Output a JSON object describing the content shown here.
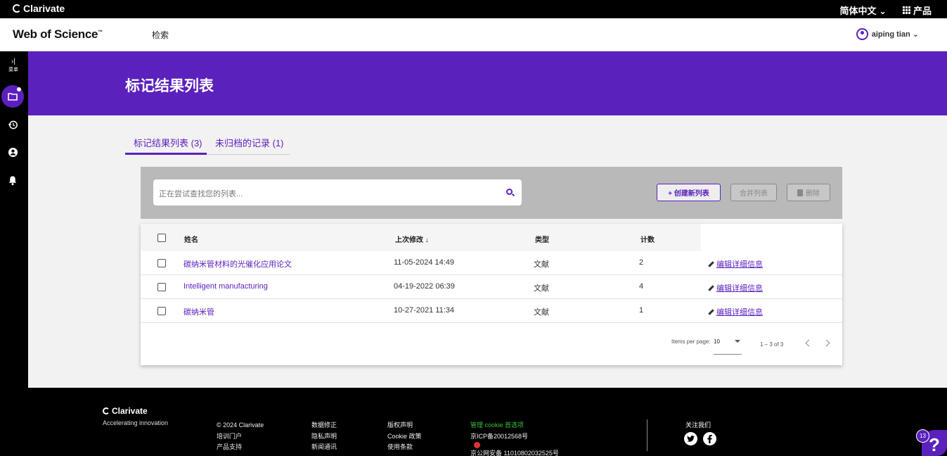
{
  "brand_bar": {
    "logo_text": "Clarivate",
    "language": "简体中文 ⌄",
    "products": "产品"
  },
  "app_header": {
    "product_name": "Web of Science",
    "trademark": "™",
    "nav_search": "检索",
    "user_name": "aiping tian ⌄"
  },
  "rail": {
    "expand_glyph": "›|",
    "expand_label": "菜单"
  },
  "page": {
    "title": "标记结果列表"
  },
  "tabs": [
    {
      "label": "标记结果列表 (3)",
      "active": true
    },
    {
      "label": "未归档的记录 (1)",
      "active": false
    }
  ],
  "toolbar": {
    "search_placeholder": "正在尝试查找您的列表...",
    "create_label": "+ 创建新列表",
    "merge_label": "合并列表",
    "delete_label": "删除"
  },
  "table": {
    "columns": {
      "name": "姓名",
      "modified": "上次修改 ↓",
      "type": "类型",
      "count": "计数"
    },
    "rows": [
      {
        "name": "碳纳米管材料的光催化应用论文",
        "modified": "11-05-2024 14:49",
        "type": "文献",
        "count": "2",
        "action": "编辑详细信息"
      },
      {
        "name": "Intelligent manufacturing",
        "modified": "04-19-2022 06:39",
        "type": "文献",
        "count": "4",
        "action": "编辑详细信息"
      },
      {
        "name": "碳纳米管",
        "modified": "10-27-2021 11:34",
        "type": "文献",
        "count": "1",
        "action": "编辑详细信息"
      }
    ],
    "pagination": {
      "items_per_page_label": "Items per page:",
      "items_per_page_value": "10",
      "range": "1 – 3 of 3"
    }
  },
  "footer": {
    "logo_text": "Clarivate",
    "tagline": "Accelerating innovation",
    "col1": [
      "© 2024 Clarivate",
      "培训门户",
      "产品支持"
    ],
    "col2": [
      "数据修正",
      "隐私声明",
      "新闻通讯"
    ],
    "col3": [
      "版权声明",
      "Cookie 政策",
      "使用条款"
    ],
    "cookie_prefs": "管理 cookie 首选项",
    "icp": "京ICP备20012568号",
    "police": "京公网安备 11010802032525号",
    "follow_us": "关注我们"
  },
  "help": {
    "badge": "13",
    "glyph": "?"
  },
  "colors": {
    "brand_purple": "#5b21bd",
    "cookie_green": "#3bc13b"
  }
}
